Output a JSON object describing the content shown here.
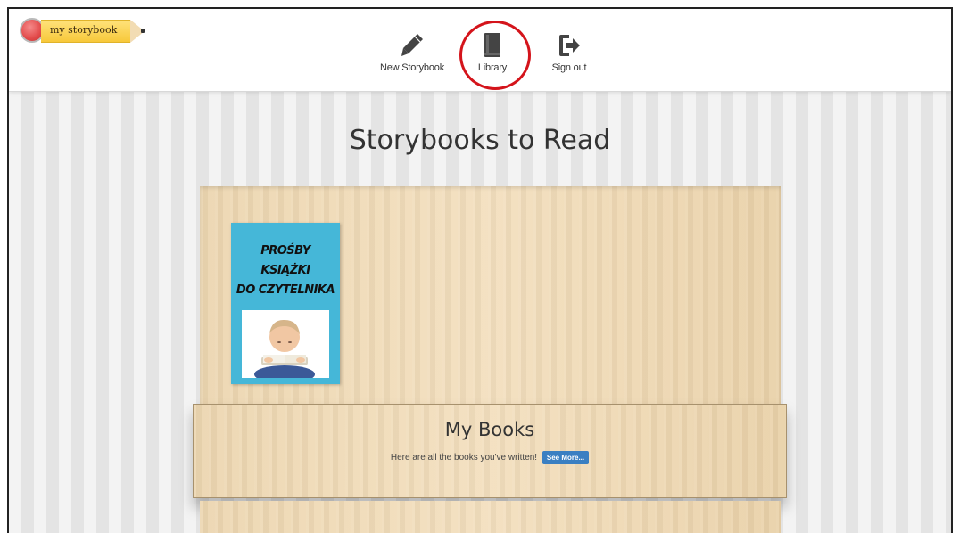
{
  "app": {
    "logo_text": "my storybook"
  },
  "nav": {
    "new_storybook": "New Storybook",
    "library": "Library",
    "sign_out": "Sign out"
  },
  "page": {
    "title": "Storybooks to Read"
  },
  "books": [
    {
      "cover_lines": [
        "PROŚBY",
        "KSIĄŻKI",
        "DO CZYTELNIKA"
      ]
    }
  ],
  "shelf": {
    "heading": "My Books",
    "subtext": "Here are all the books you've written!",
    "button": "See More..."
  },
  "colors": {
    "highlight_circle": "#d4141b",
    "cover_background": "#45b7d8",
    "see_more_button": "#3a7fc2",
    "eraser": "#e24a4a",
    "pencil_body": "#f7c83a"
  },
  "icons": {
    "new_storybook": "pencil-icon",
    "library": "book-icon",
    "sign_out": "sign-out-icon"
  }
}
